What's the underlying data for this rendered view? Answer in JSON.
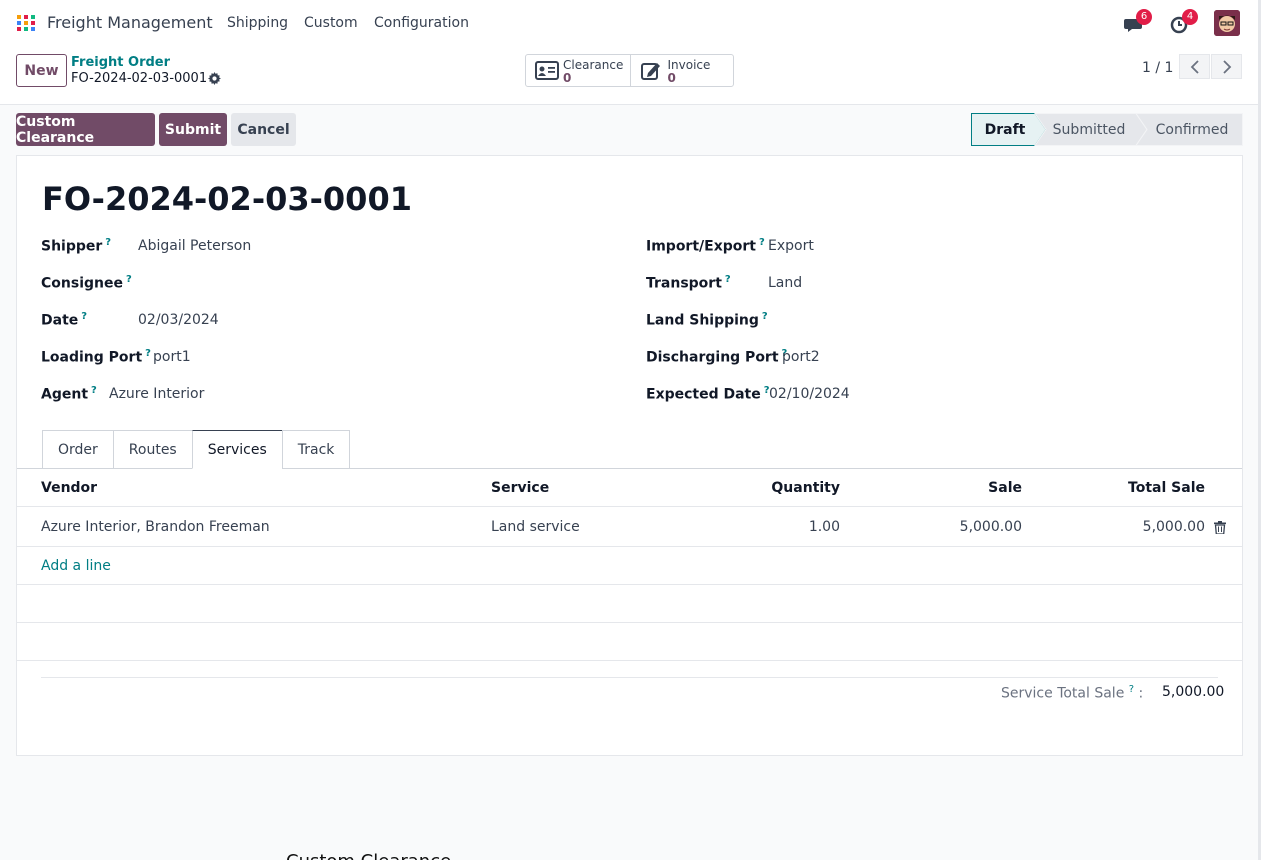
{
  "navbar": {
    "app_name": "Freight Management",
    "menu": [
      "Shipping",
      "Custom",
      "Configuration"
    ],
    "messages_count": "6",
    "activities_count": "4"
  },
  "control_panel": {
    "new_label": "New",
    "breadcrumb_parent": "Freight Order",
    "breadcrumb_current": "FO-2024-02-03-0001",
    "smart_buttons": [
      {
        "label": "Clearance",
        "value": "0",
        "icon": "id-card-icon"
      },
      {
        "label": "Invoice",
        "value": "0",
        "icon": "edit-icon"
      }
    ],
    "pager": "1 / 1"
  },
  "actions": {
    "custom_clearance": "Custom Clearance",
    "submit": "Submit",
    "cancel": "Cancel"
  },
  "status": {
    "stages": [
      "Draft",
      "Submitted",
      "Confirmed"
    ],
    "current": "Draft"
  },
  "form": {
    "title": "FO-2024-02-03-0001",
    "left": {
      "shipper_label": "Shipper",
      "shipper": "Abigail Peterson",
      "consignee_label": "Consignee",
      "consignee": "",
      "date_label": "Date",
      "date": "02/03/2024",
      "loading_port_label": "Loading Port",
      "loading_port": "port1",
      "agent_label": "Agent",
      "agent": "Azure Interior"
    },
    "right": {
      "import_export_label": "Import/Export",
      "import_export": "Export",
      "transport_label": "Transport",
      "transport": "Land",
      "land_shipping_label": "Land Shipping",
      "land_shipping": "",
      "discharging_port_label": "Discharging Port",
      "discharging_port": "port2",
      "expected_date_label": "Expected Date",
      "expected_date": "02/10/2024"
    },
    "tabs": [
      "Order",
      "Routes",
      "Services",
      "Track"
    ],
    "active_tab": "Services",
    "services": {
      "columns": [
        "Vendor",
        "Service",
        "Quantity",
        "Sale",
        "Total Sale"
      ],
      "rows": [
        {
          "vendor": "Azure Interior, Brandon Freeman",
          "service": "Land service",
          "quantity": "1.00",
          "sale": "5,000.00",
          "total": "5,000.00"
        }
      ],
      "add_line": "Add a line"
    },
    "total_label": "Service Total Sale",
    "total_value": "5,000.00"
  },
  "background_text": "Custom Clearance",
  "colors": {
    "brand": "#714b67",
    "accent": "#017e84",
    "badge": "#e11d48"
  }
}
